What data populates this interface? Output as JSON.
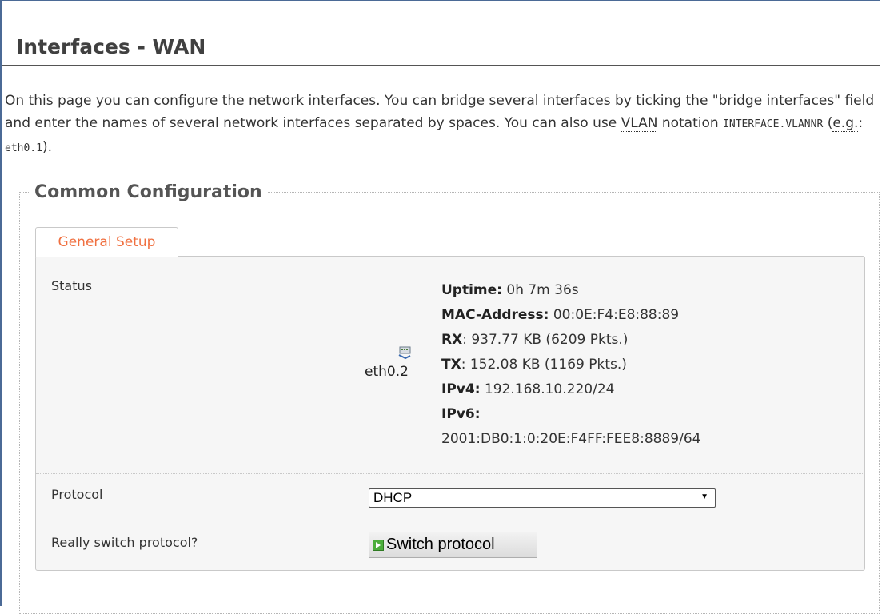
{
  "page": {
    "title": "Interfaces - WAN",
    "description": {
      "text1": "On this page you can configure the network interfaces. You can bridge several interfaces by ticking the \"bridge interfaces\" field and enter the names of several network interfaces separated by spaces. You can also use ",
      "vlan_abbr": "VLAN",
      "text2": " notation ",
      "notation_mono": "INTERFACE.VLANNR",
      "text3": " (",
      "eg_abbr": "e.g.",
      "text4": ": ",
      "example_mono": "eth0.1",
      "text5": ")."
    }
  },
  "section": {
    "legend": "Common Configuration",
    "tab_label": "General Setup"
  },
  "status": {
    "label": "Status",
    "icon": "ethernet-port-icon",
    "interface": "eth0.2",
    "uptime_label": "Uptime:",
    "uptime_value": " 0h 7m 36s",
    "mac_label": "MAC-Address:",
    "mac_value": " 00:0E:F4:E8:88:89",
    "rx_label": "RX",
    "rx_value": ": 937.77 KB (6209 Pkts.)",
    "tx_label": "TX",
    "tx_value": ": 152.08 KB (1169 Pkts.)",
    "ipv4_label": "IPv4:",
    "ipv4_value": " 192.168.10.220/24",
    "ipv6_label": "IPv6:",
    "ipv6_value": "2001:DB0:1:0:20E:F4FF:FEE8:8889/64"
  },
  "protocol": {
    "label": "Protocol",
    "selected": "DHCP"
  },
  "switch": {
    "label": "Really switch protocol?",
    "button": "Switch protocol"
  },
  "colors": {
    "accent_tab": "#f07040",
    "frame_border": "#4b6a96",
    "panel_bg": "#f6f6f6"
  }
}
